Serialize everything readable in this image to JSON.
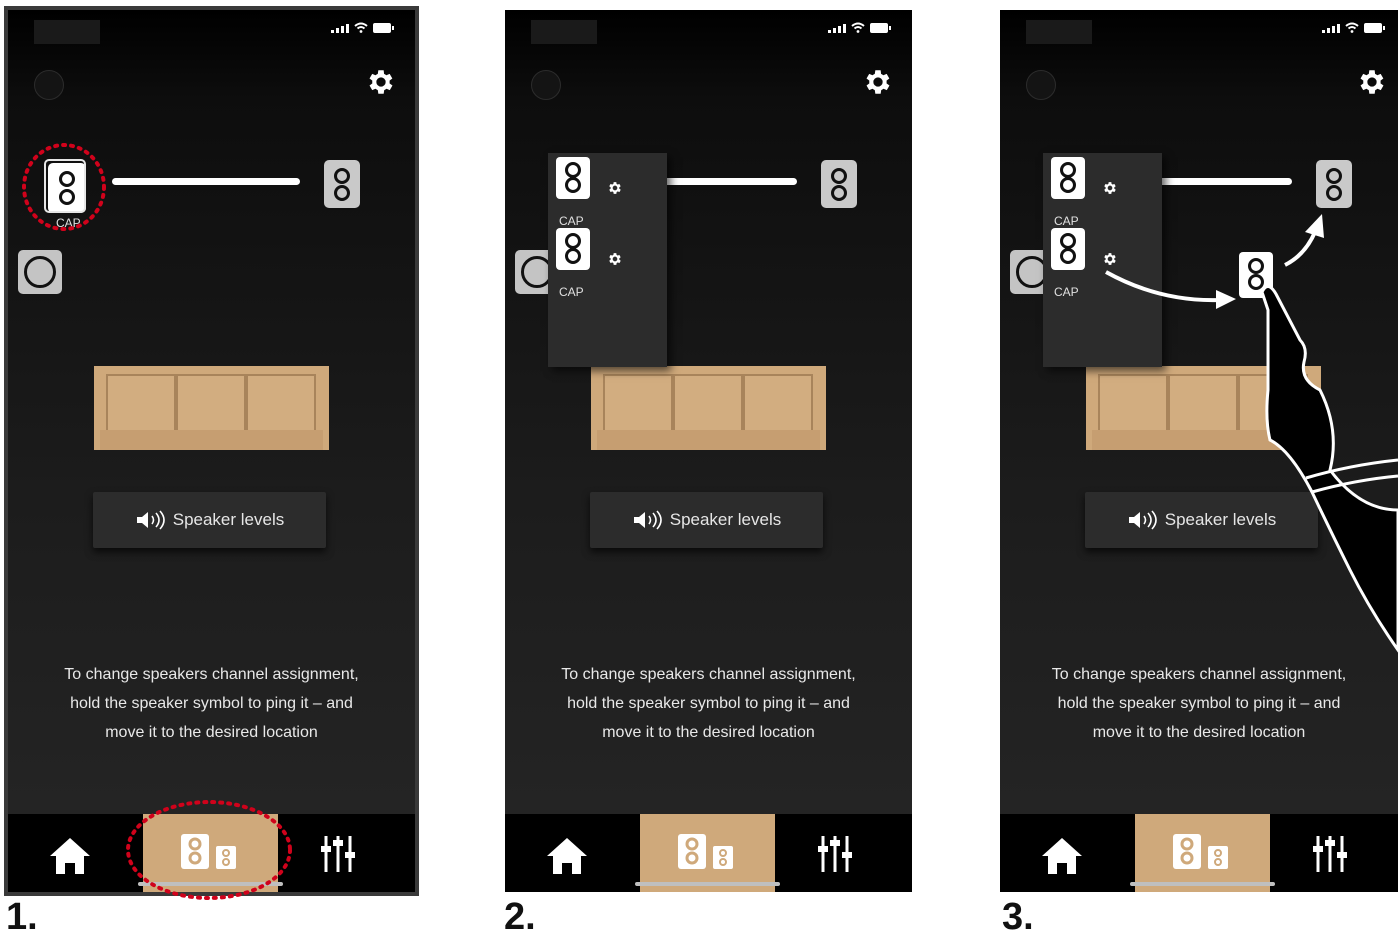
{
  "steps": [
    {
      "number": "1."
    },
    {
      "number": "2."
    },
    {
      "number": "3."
    }
  ],
  "app": {
    "speaker_tag": "CAP",
    "speaker_levels_label": "Speaker levels",
    "instructions": [
      "To change speakers channel assignment,",
      "hold the speaker symbol to ping it – and",
      "move it to the desired location"
    ],
    "icons": {
      "settings": "gear-icon",
      "speaker": "speaker-icon",
      "volume": "speaker-volume-icon",
      "home": "home-icon",
      "speakers_tab": "speakers-icon",
      "equalizer": "equalizer-sliders-icon"
    },
    "colors": {
      "accent": "#cfa97b",
      "highlight": "#d0021b",
      "background": "#1c1c1c"
    }
  }
}
